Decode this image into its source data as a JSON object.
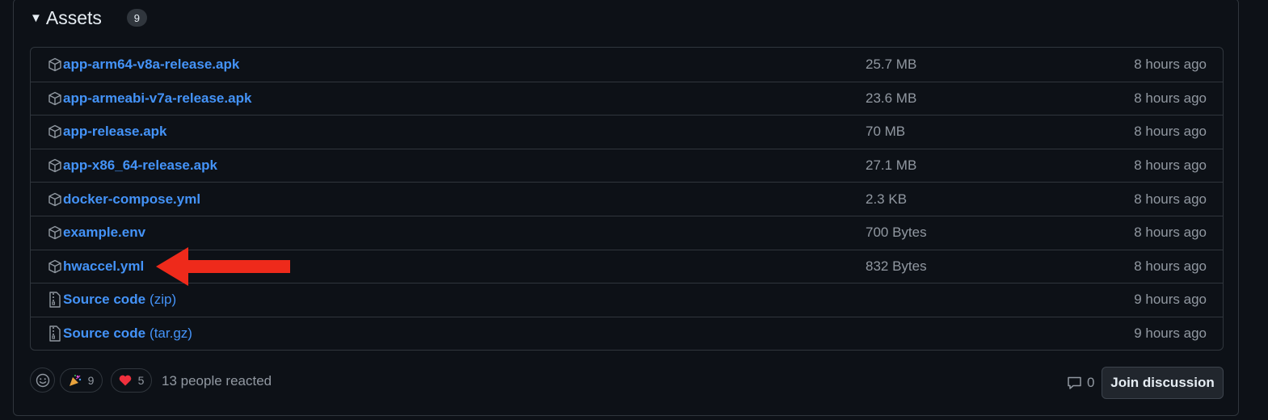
{
  "assets": {
    "caret_glyph": "▼",
    "title": "Assets",
    "count": "9",
    "items": [
      {
        "name": "app-arm64-v8a-release.apk",
        "suffix": "",
        "size": "25.7 MB",
        "time": "8 hours ago",
        "icon": "package-icon"
      },
      {
        "name": "app-armeabi-v7a-release.apk",
        "suffix": "",
        "size": "23.6 MB",
        "time": "8 hours ago",
        "icon": "package-icon"
      },
      {
        "name": "app-release.apk",
        "suffix": "",
        "size": "70 MB",
        "time": "8 hours ago",
        "icon": "package-icon"
      },
      {
        "name": "app-x86_64-release.apk",
        "suffix": "",
        "size": "27.1 MB",
        "time": "8 hours ago",
        "icon": "package-icon"
      },
      {
        "name": "docker-compose.yml",
        "suffix": "",
        "size": "2.3 KB",
        "time": "8 hours ago",
        "icon": "package-icon"
      },
      {
        "name": "example.env",
        "suffix": "",
        "size": "700 Bytes",
        "time": "8 hours ago",
        "icon": "package-icon"
      },
      {
        "name": "hwaccel.yml",
        "suffix": "",
        "size": "832 Bytes",
        "time": "8 hours ago",
        "icon": "package-icon"
      },
      {
        "name": "Source code",
        "suffix": "(zip)",
        "size": "",
        "time": "9 hours ago",
        "icon": "file-zip-icon"
      },
      {
        "name": "Source code",
        "suffix": "(tar.gz)",
        "size": "",
        "time": "9 hours ago",
        "icon": "file-zip-icon"
      }
    ]
  },
  "annotation": {
    "arrow_color": "#ee2a1b",
    "points_to": "hwaccel.yml"
  },
  "reactions": {
    "tada_count": "9",
    "heart_count": "5",
    "summary": "13 people reacted"
  },
  "discussion": {
    "comment_count": "0",
    "join_label": "Join discussion"
  },
  "colors": {
    "background": "#0d1117",
    "border": "#30363d",
    "link": "#4493f8",
    "muted": "#9198a1"
  }
}
